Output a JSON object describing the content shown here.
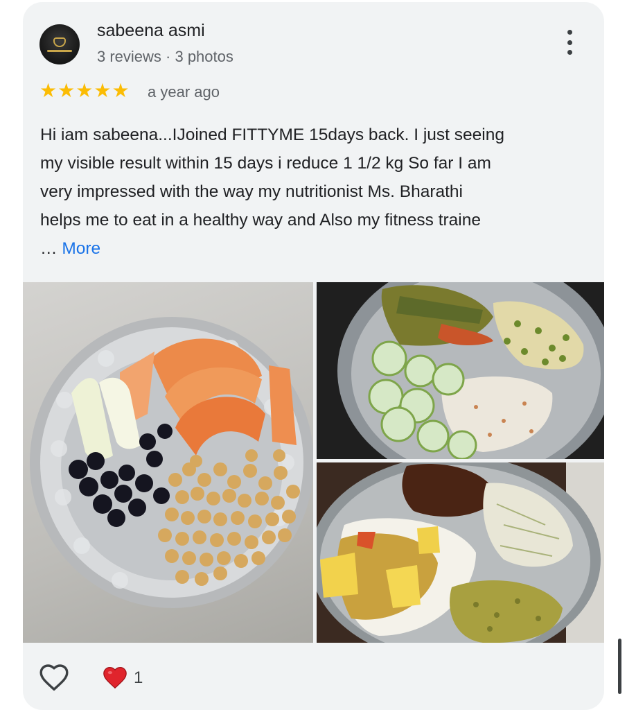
{
  "review": {
    "author": "sabeena asmi",
    "author_meta": "3 reviews · 3 photos",
    "rating_stars": 5,
    "time": "a year ago",
    "text_lines": [
      "Hi iam sabeena...IJoined FITTYME 15days back. I just seeing",
      "my visible result within 15 days i reduce 1 1/2 kg So far I am",
      "very impressed with the way my nutritionist Ms. Bharathi",
      "helps me to eat in a healthy way and Also my fitness traine"
    ],
    "ellipsis": "…",
    "more_label": "More",
    "like_count": "1"
  },
  "icons": {
    "star": "star-icon",
    "menu": "more-vert-icon",
    "like": "heart-outline-icon",
    "reaction": "red-heart-icon"
  },
  "colors": {
    "star": "#fbbc04",
    "link": "#1a73e8",
    "reaction": "#e0242c",
    "card_bg": "#f1f3f4"
  }
}
